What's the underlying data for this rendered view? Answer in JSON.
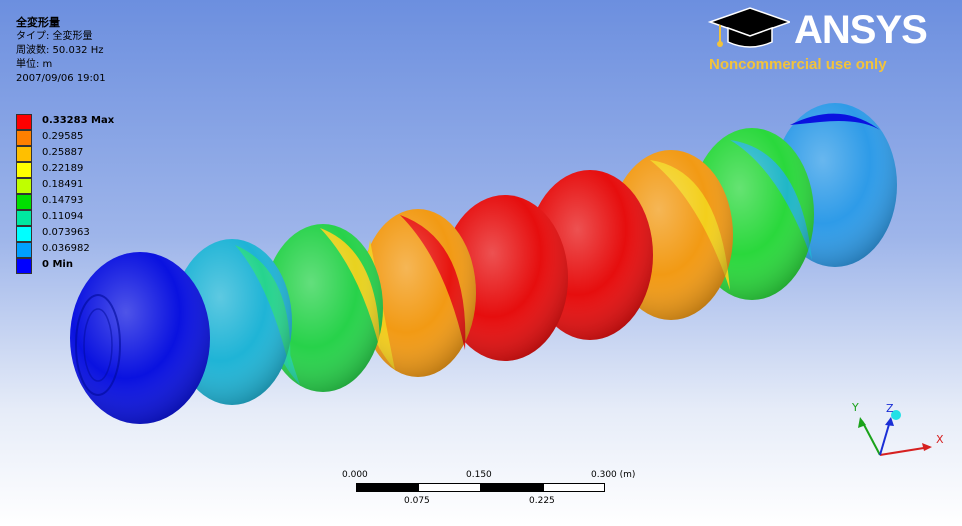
{
  "info": {
    "title": "全変形量",
    "type_line": "タイプ: 全変形量",
    "frequency_line": "周波数: 50.032 Hz",
    "unit_line": "単位: m",
    "timestamp": "2007/09/06 19:01"
  },
  "legend": {
    "entries": [
      {
        "label": "0.33283 Max",
        "color": "#ff0000",
        "bold": true
      },
      {
        "label": "0.29585",
        "color": "#ff7f00",
        "bold": false
      },
      {
        "label": "0.25887",
        "color": "#ffbf00",
        "bold": false
      },
      {
        "label": "0.22189",
        "color": "#ffff00",
        "bold": false
      },
      {
        "label": "0.18491",
        "color": "#bfff00",
        "bold": false
      },
      {
        "label": "0.14793",
        "color": "#00e000",
        "bold": false
      },
      {
        "label": "0.11094",
        "color": "#00e8a0",
        "bold": false
      },
      {
        "label": "0.073963",
        "color": "#00ffff",
        "bold": false
      },
      {
        "label": "0.036982",
        "color": "#00a0ff",
        "bold": false
      },
      {
        "label": "0 Min",
        "color": "#0000ff",
        "bold": true
      }
    ]
  },
  "logo": {
    "brand": "ANSYS",
    "subtitle": "Noncommercial use only",
    "brand_color": "#ffffff",
    "subtitle_color": "#f2c33b"
  },
  "scale_bar": {
    "top_labels": [
      "0.000",
      "0.150",
      "0.300 (m)"
    ],
    "bottom_labels": [
      "0.075",
      "0.225"
    ]
  },
  "triad": {
    "x_label": "X",
    "y_label": "Y",
    "z_label": "Z"
  },
  "model": {
    "description_colors": [
      "#0a12e0",
      "#1fb4d6",
      "#27d24a",
      "#f2d21c",
      "#e60e0e",
      "#e60e0e",
      "#f29a14",
      "#2ad83c",
      "#2e9be8"
    ]
  }
}
